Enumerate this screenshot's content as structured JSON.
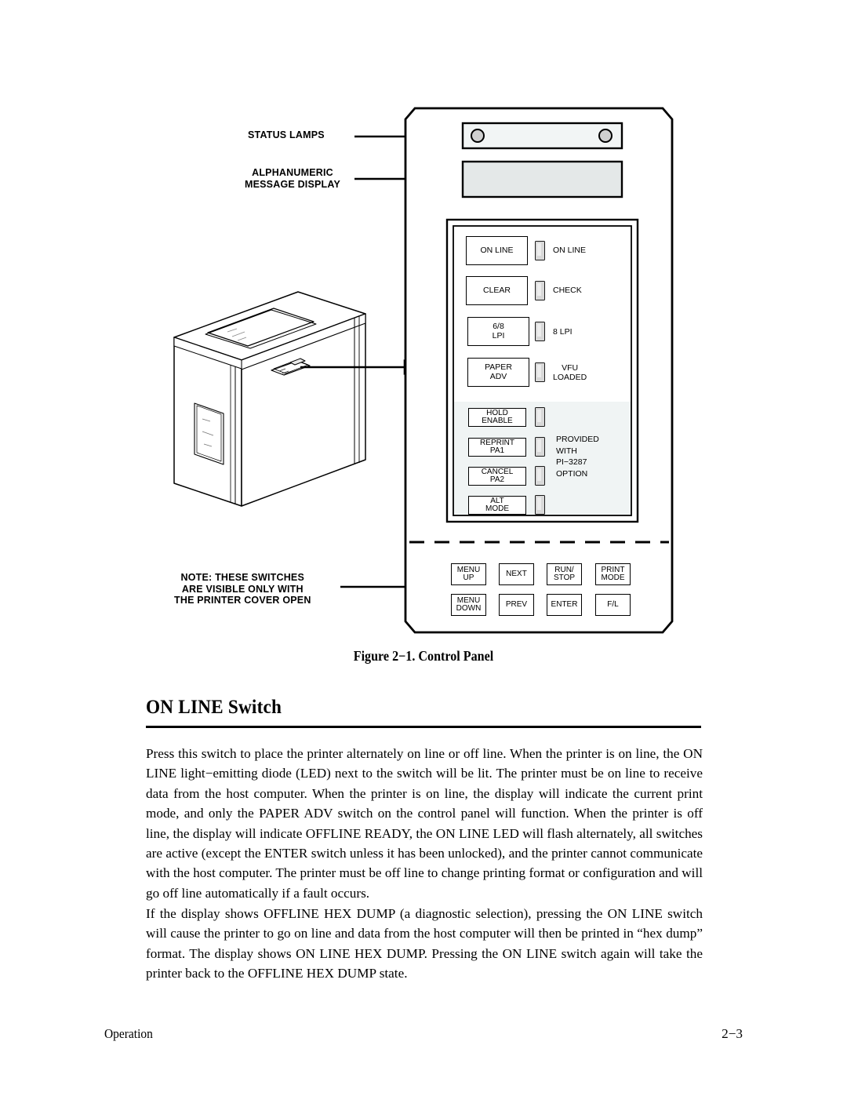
{
  "figure": {
    "caption": "Figure 2−1. Control Panel",
    "callouts": [
      {
        "id": "status-lamps",
        "lines": [
          "STATUS LAMPS"
        ]
      },
      {
        "id": "alphanumeric-display",
        "lines": [
          "ALPHANUMERIC",
          "MESSAGE DISPLAY"
        ]
      },
      {
        "id": "cover-note",
        "lines": [
          "NOTE: THESE SWITCHES",
          "ARE VISIBLE ONLY WITH",
          "THE PRINTER COVER OPEN"
        ]
      }
    ],
    "panel": {
      "switch_rows": [
        {
          "switch": "ON LINE",
          "lamp_label": "ON LINE"
        },
        {
          "switch": "CLEAR",
          "lamp_label": "CHECK"
        },
        {
          "switch": "6/8\nLPI",
          "lamp_label": "8 LPI"
        },
        {
          "switch": "PAPER\nADV",
          "lamp_label": "VFU\nLOADED"
        },
        {
          "switch": "HOLD\nENABLE",
          "lamp_label": ""
        },
        {
          "switch": "REPRINT\nPA1",
          "lamp_label": ""
        },
        {
          "switch": "CANCEL\nPA2",
          "lamp_label": ""
        },
        {
          "switch": "ALT\nMODE",
          "lamp_label": ""
        }
      ],
      "option_note": [
        "PROVIDED",
        "WITH",
        "PI−3287",
        "OPTION"
      ],
      "menu_switches_row1": [
        "MENU\nUP",
        "NEXT",
        "RUN/\nSTOP",
        "PRINT\nMODE"
      ],
      "menu_switches_row2": [
        "MENU\nDOWN",
        "PREV",
        "ENTER",
        "F/L"
      ]
    },
    "colors": {
      "outline": "#000000",
      "lamp_fill": "#d8d8d8",
      "display_fill": "#e4e8e8",
      "status_strip_fill": "#f2f5f5",
      "option_shade": "#f0f4f4"
    }
  },
  "section": {
    "heading": "ON LINE Switch",
    "paragraphs": [
      "Press this switch to place the printer alternately on line or off line. When the printer is on line, the ON LINE light−emitting diode (LED) next to the switch will be lit. The printer must be on line to receive data from the host computer. When the printer is on line, the display will indicate the current print mode, and only the PAPER ADV switch on the control panel will function. When the printer is off line, the display will indicate OFFLINE READY, the ON LINE LED will flash alternately, all switches are active (except the ENTER switch unless it has been unlocked), and the printer cannot communicate with the host computer. The printer must be off line to change printing format or configuration and will go off line automatically if a fault occurs.",
      "If the display shows OFFLINE HEX DUMP (a diagnostic selection), pressing the ON LINE switch will cause the printer to go on line and data from the host computer will then be printed in “hex dump” format. The display shows ON LINE HEX DUMP. Pressing the ON LINE switch again will take the printer back to the OFFLINE HEX DUMP state."
    ]
  },
  "footer": {
    "left": "Operation",
    "page_number": "2−3"
  }
}
